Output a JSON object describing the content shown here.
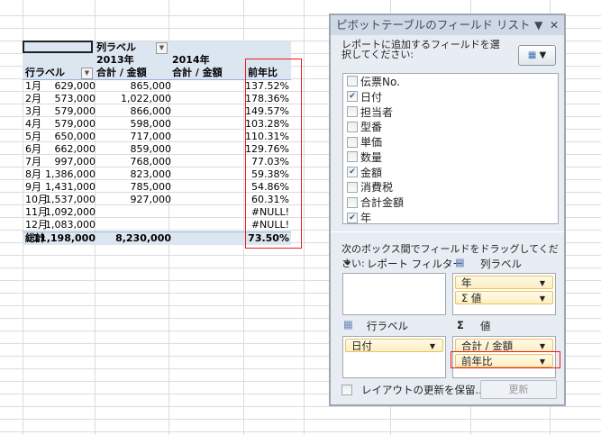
{
  "pivot": {
    "col_label": "列ラベル",
    "row_label": "行ラベル",
    "years": [
      "2013年",
      "2014年"
    ],
    "measure": "合計 / 金額",
    "ratio_header": "前年比",
    "rows": [
      {
        "label": "1月",
        "y2013": "629,000",
        "y2014": "865,000",
        "ratio": "137.52%"
      },
      {
        "label": "2月",
        "y2013": "573,000",
        "y2014": "1,022,000",
        "ratio": "178.36%"
      },
      {
        "label": "3月",
        "y2013": "579,000",
        "y2014": "866,000",
        "ratio": "149.57%"
      },
      {
        "label": "4月",
        "y2013": "579,000",
        "y2014": "598,000",
        "ratio": "103.28%"
      },
      {
        "label": "5月",
        "y2013": "650,000",
        "y2014": "717,000",
        "ratio": "110.31%"
      },
      {
        "label": "6月",
        "y2013": "662,000",
        "y2014": "859,000",
        "ratio": "129.76%"
      },
      {
        "label": "7月",
        "y2013": "997,000",
        "y2014": "768,000",
        "ratio": "77.03%"
      },
      {
        "label": "8月",
        "y2013": "1,386,000",
        "y2014": "823,000",
        "ratio": "59.38%"
      },
      {
        "label": "9月",
        "y2013": "1,431,000",
        "y2014": "785,000",
        "ratio": "54.86%"
      },
      {
        "label": "10月",
        "y2013": "1,537,000",
        "y2014": "927,000",
        "ratio": "60.31%"
      },
      {
        "label": "11月",
        "y2013": "1,092,000",
        "y2014": "",
        "ratio": "#NULL!"
      },
      {
        "label": "12月",
        "y2013": "1,083,000",
        "y2014": "",
        "ratio": "#NULL!"
      }
    ],
    "total": {
      "label": "総計",
      "y2013": "11,198,000",
      "y2014": "8,230,000",
      "ratio": "73.50%"
    }
  },
  "panel": {
    "title": "ピボットテーブルのフィールド リスト",
    "instruction": "レポートに追加するフィールドを選択してください:",
    "fields": [
      {
        "label": "伝票No.",
        "checked": false
      },
      {
        "label": "日付",
        "checked": true
      },
      {
        "label": "担当者",
        "checked": false
      },
      {
        "label": "型番",
        "checked": false
      },
      {
        "label": "単価",
        "checked": false
      },
      {
        "label": "数量",
        "checked": false
      },
      {
        "label": "金額",
        "checked": true
      },
      {
        "label": "消費税",
        "checked": false
      },
      {
        "label": "合計金額",
        "checked": false
      },
      {
        "label": "年",
        "checked": true
      }
    ],
    "drag_instruction": "次のボックス間でフィールドをドラッグしてください:",
    "report_filter": "レポート フィルター",
    "column_labels": "列ラベル",
    "row_labels": "行ラベル",
    "values": "値",
    "column_chips": [
      "年",
      "Σ 値"
    ],
    "row_chips": [
      "日付"
    ],
    "value_chips": [
      "合計 / 金額",
      "前年比"
    ],
    "defer_label": "レイアウトの更新を保留...",
    "update_button": "更新"
  }
}
